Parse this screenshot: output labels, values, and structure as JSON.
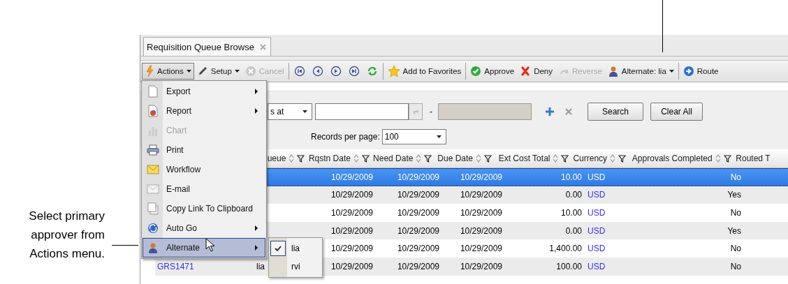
{
  "callouts": [
    {
      "text": "Select primary approver from Actions menu."
    }
  ],
  "tab": {
    "label": "Requisition Queue Browse"
  },
  "toolbar": {
    "items": [
      {
        "kind": "menu-button",
        "label": "Actions",
        "pressed": true,
        "disabled": false
      },
      {
        "kind": "menu-button",
        "label": "Setup",
        "pressed": false,
        "disabled": false
      },
      {
        "kind": "button",
        "label": "Cancel",
        "pressed": false,
        "disabled": true
      },
      {
        "kind": "separator"
      },
      {
        "kind": "icon-button",
        "pressed": false,
        "disabled": false
      },
      {
        "kind": "icon-button",
        "pressed": false,
        "disabled": false
      },
      {
        "kind": "icon-button",
        "pressed": false,
        "disabled": false
      },
      {
        "kind": "icon-button",
        "pressed": false,
        "disabled": false
      },
      {
        "kind": "icon-button",
        "pressed": false,
        "disabled": false
      },
      {
        "kind": "separator"
      },
      {
        "kind": "button",
        "label": "Add to Favorites",
        "pressed": false,
        "disabled": false
      },
      {
        "kind": "separator"
      },
      {
        "kind": "button",
        "label": "Approve",
        "pressed": false,
        "disabled": false
      },
      {
        "kind": "button",
        "label": "Deny",
        "pressed": false,
        "disabled": false
      },
      {
        "kind": "button",
        "label": "Reverse",
        "pressed": false,
        "disabled": true
      },
      {
        "kind": "menu-button",
        "label": "Alternate: lia",
        "pressed": false,
        "disabled": false
      },
      {
        "kind": "separator"
      },
      {
        "kind": "button",
        "label": "Route",
        "pressed": false,
        "disabled": false
      }
    ]
  },
  "search": {
    "operator": "s at",
    "dash": "-",
    "buttons": [
      "Search",
      "Clear All"
    ]
  },
  "records_per_page": {
    "label": "Records per page:",
    "value": "100"
  },
  "table": {
    "columns": [
      {
        "label": "ueue"
      },
      {
        "label": "Rqstn Date"
      },
      {
        "label": "Need Date"
      },
      {
        "label": "Due Date"
      },
      {
        "label": "Ext Cost Total"
      },
      {
        "label": "Currency"
      },
      {
        "label": "Approvals Completed"
      },
      {
        "label": "Routed T"
      }
    ],
    "rows": [
      {
        "selected": true,
        "rqstn_date": "10/29/2009",
        "need_date": "10/29/2009",
        "due_date": "10/29/2009",
        "ext_cost_total": "10.00",
        "currency": "USD",
        "approvals_completed": "No"
      },
      {
        "selected": false,
        "rqstn_date": "10/29/2009",
        "need_date": "10/29/2009",
        "due_date": "10/29/2009",
        "ext_cost_total": "0.00",
        "currency": "USD",
        "approvals_completed": "Yes"
      },
      {
        "selected": false,
        "rqstn_date": "10/29/2009",
        "need_date": "10/29/2009",
        "due_date": "10/29/2009",
        "ext_cost_total": "10.00",
        "currency": "USD",
        "approvals_completed": "No"
      },
      {
        "selected": false,
        "rqstn_date": "10/29/2009",
        "need_date": "10/29/2009",
        "due_date": "10/29/2009",
        "ext_cost_total": "0.00",
        "currency": "USD",
        "approvals_completed": "Yes"
      },
      {
        "selected": false,
        "rqstn_date": "10/29/2009",
        "need_date": "10/29/2009",
        "due_date": "10/29/2009",
        "ext_cost_total": "1,400.00",
        "currency": "USD",
        "approvals_completed": "No"
      },
      {
        "selected": false,
        "id": "GRS1471",
        "queue": "lia",
        "rqstn_date": "10/29/2009",
        "need_date": "10/29/2009",
        "due_date": "10/29/2009",
        "ext_cost_total": "100.00",
        "currency": "USD",
        "approvals_completed": "No"
      }
    ]
  },
  "actions_menu": {
    "items": [
      {
        "label": "Export",
        "submenu": true,
        "disabled": false,
        "selected": false
      },
      {
        "label": "Report",
        "submenu": true,
        "disabled": false,
        "selected": false
      },
      {
        "label": "Chart",
        "submenu": false,
        "disabled": true,
        "selected": false
      },
      {
        "label": "Print",
        "submenu": false,
        "disabled": false,
        "selected": false
      },
      {
        "label": "Workflow",
        "submenu": false,
        "disabled": false,
        "selected": false
      },
      {
        "label": "E-mail",
        "submenu": false,
        "disabled": false,
        "selected": false
      },
      {
        "label": "Copy Link To Clipboard",
        "submenu": false,
        "disabled": false,
        "selected": false
      },
      {
        "label": "Auto Go",
        "submenu": true,
        "disabled": false,
        "selected": false
      },
      {
        "label": "Alternate",
        "submenu": true,
        "disabled": false,
        "selected": true
      }
    ],
    "alternate_submenu": {
      "items": [
        {
          "label": "lia",
          "checked": true
        },
        {
          "label": "rvi",
          "checked": false
        }
      ]
    }
  }
}
